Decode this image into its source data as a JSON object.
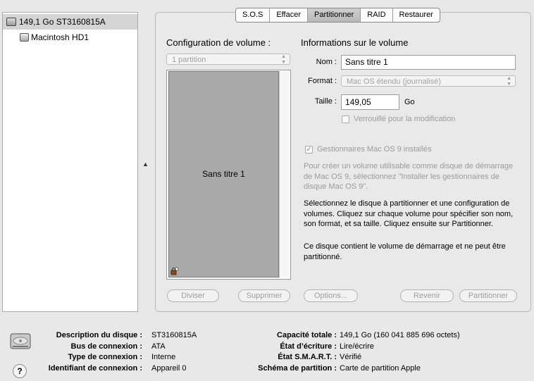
{
  "sidebar": {
    "disk": "149,1 Go ST3160815A",
    "volume": "Macintosh HD1"
  },
  "tabs": [
    {
      "label": "S.O.S"
    },
    {
      "label": "Effacer"
    },
    {
      "label": "Partitionner"
    },
    {
      "label": "RAID"
    },
    {
      "label": "Restaurer"
    }
  ],
  "active_tab": "Partitionner",
  "config": {
    "title": "Configuration de volume :",
    "scheme": "1 partition",
    "partition_name": "Sans titre 1"
  },
  "info": {
    "title": "Informations sur le volume",
    "name_label": "Nom :",
    "name_value": "Sans titre 1",
    "format_label": "Format :",
    "format_value": "Mac OS étendu (journalisé)",
    "size_label": "Taille :",
    "size_value": "149,05",
    "size_unit": "Go",
    "locked_label": "Verrouillé pour la modification",
    "locked_checked": false,
    "os9_label": "Gestionnaires Mac OS 9 installés",
    "os9_checked": true,
    "os9_help": "Pour créer un volume utilisable comme disque de démarrage de Mac OS 9, sélectionnez \"Installer les gestionnaires de disque Mac OS 9\".",
    "instructions": "Sélectionnez le disque à partitionner et une configuration de volumes. Cliquez sur chaque volume pour spécifier son nom, son format, et sa taille. Cliquez ensuite sur Partitionner.",
    "startup_note": "Ce disque contient le volume de démarrage et ne peut être partitionné."
  },
  "buttons": {
    "split": "Diviser",
    "delete": "Supprimer",
    "options": "Options...",
    "revert": "Revenir",
    "partition": "Partitionner"
  },
  "disk_info": {
    "left": [
      {
        "label": "Description du disque :",
        "value": "ST3160815A"
      },
      {
        "label": "Bus de connexion :",
        "value": "ATA"
      },
      {
        "label": "Type de connexion :",
        "value": "Interne"
      },
      {
        "label": "Identifiant de connexion :",
        "value": "Appareil 0"
      }
    ],
    "right": [
      {
        "label": "Capacité totale :",
        "value": "149,1 Go (160 041 885 696 octets)"
      },
      {
        "label": "État d’écriture :",
        "value": "Lire/écrire"
      },
      {
        "label": "État S.M.A.R.T. :",
        "value": "Vérifié"
      },
      {
        "label": "Schéma de partition :",
        "value": "Carte de partition Apple"
      }
    ]
  },
  "icons": {
    "disk": "hard-disk-icon",
    "volume": "volume-icon",
    "lock": "lock-icon",
    "help": "help-icon"
  }
}
